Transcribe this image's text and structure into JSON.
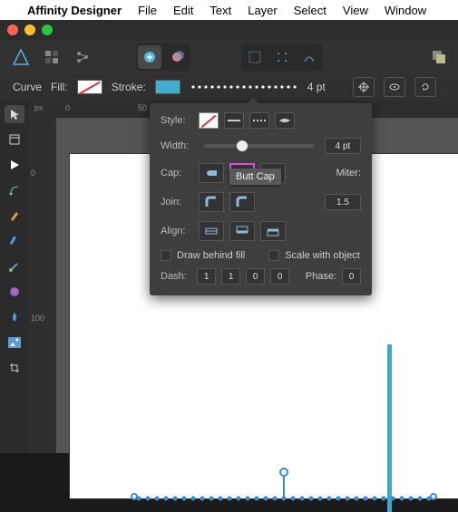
{
  "menubar": {
    "appname": "Affinity Designer",
    "items": [
      "File",
      "Edit",
      "Text",
      "Layer",
      "Select",
      "View",
      "Window"
    ]
  },
  "contextbar": {
    "mode_label": "Curve",
    "fill_label": "Fill:",
    "stroke_label": "Stroke:",
    "stroke_width": "4 pt"
  },
  "popover": {
    "style_label": "Style:",
    "width_label": "Width:",
    "width_value": "4 pt",
    "cap_label": "Cap:",
    "join_label": "Join:",
    "align_label": "Align:",
    "miter_label": "Miter:",
    "miter_value": "1.5",
    "draw_behind": "Draw behind fill",
    "scale_with": "Scale with object",
    "dash_label": "Dash:",
    "dash_values": [
      "1",
      "1",
      "0",
      "0"
    ],
    "phase_label": "Phase:",
    "phase_value": "0",
    "tooltip": "Butt Cap"
  },
  "ruler": {
    "px_label": "px",
    "top_ticks": [
      {
        "v": "0",
        "p": 40
      },
      {
        "v": "50",
        "p": 120
      }
    ],
    "left_ticks": [
      {
        "v": "0",
        "p": 60
      },
      {
        "v": "100",
        "p": 220
      }
    ]
  },
  "colors": {
    "stroke": "#40aed0",
    "accent": "#3a88d6"
  }
}
